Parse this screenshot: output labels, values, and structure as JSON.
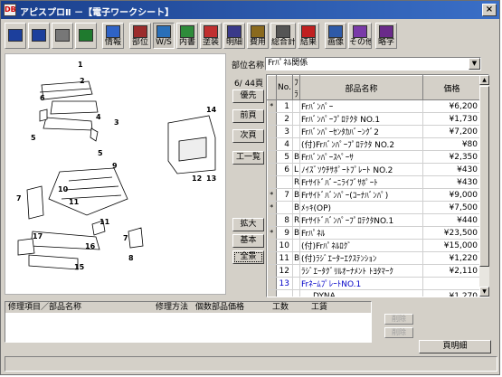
{
  "window": {
    "app_icon": "DB",
    "title": "アピスプロⅡ －【電子ワークシート】",
    "close_label": "×"
  },
  "toolbar": {
    "buttons": [
      {
        "icon": "save-icon",
        "label": "",
        "color": "#1c3f9c"
      },
      {
        "icon": "save-as-icon",
        "label": "",
        "color": "#1c3f9c"
      },
      {
        "icon": "print-icon",
        "label": "",
        "color": "#777777"
      },
      {
        "icon": "exit-door-icon",
        "label": "",
        "color": "#1f7a2e"
      },
      {
        "icon": "info-icon",
        "label": "情報",
        "color": "#2f63c6"
      },
      {
        "icon": "parts-icon",
        "label": "部位",
        "color": "#9b2c2c"
      },
      {
        "icon": "worksheet-icon",
        "label": "W/S",
        "color": "#2a6fb8"
      },
      {
        "icon": "details-icon",
        "label": "内書",
        "color": "#2e8b3a"
      },
      {
        "icon": "paint-icon",
        "label": "塗装",
        "color": "#c03030"
      },
      {
        "icon": "statement-icon",
        "label": "明細",
        "color": "#3a3a8a"
      },
      {
        "icon": "cost-icon",
        "label": "費用",
        "color": "#8a6a1e"
      },
      {
        "icon": "total-icon",
        "label": "総合計",
        "color": "#555555"
      },
      {
        "icon": "result-icon",
        "label": "結果",
        "color": "#c02020"
      },
      {
        "icon": "image-icon",
        "label": "画像",
        "color": "#2e5aa8"
      },
      {
        "icon": "other-icon",
        "label": "その他",
        "color": "#7a3aa8"
      },
      {
        "icon": "abbreviation-icon",
        "label": "略字",
        "color": "#6a2a8a"
      }
    ]
  },
  "parts_field": {
    "label": "部位名称",
    "value": "Frﾊﾟﾈﾙ関係"
  },
  "page_indicator": "6/ 44頁",
  "nav_buttons": {
    "priority": "優先",
    "prev": "前頁",
    "next": "次頁",
    "list": "工一覧"
  },
  "zoom_buttons": {
    "zoom_in": "拡大",
    "base": "基本",
    "full": "全景"
  },
  "diagram_labels": [
    "1",
    "2",
    "3",
    "4",
    "5",
    "5",
    "6",
    "7",
    "7",
    "8",
    "9",
    "10",
    "11",
    "11",
    "12",
    "13",
    "14",
    "15",
    "16",
    "17"
  ],
  "grid": {
    "columns": [
      "No.",
      "ﾌﾗ",
      "部品名称",
      "価格"
    ],
    "rows": [
      {
        "mark": "*",
        "no": "1",
        "flag": "",
        "name": "Frﾊﾞﾝﾊﾟｰ",
        "price": "¥6,200"
      },
      {
        "mark": "",
        "no": "2",
        "flag": "",
        "name": "Frﾊﾞﾝﾊﾟｰﾌﾟﾛﾃｸﾀ NO.1",
        "price": "¥1,730"
      },
      {
        "mark": "",
        "no": "3",
        "flag": "",
        "name": "Frﾊﾞﾝﾊﾟｰｾﾝﾀｶﾊﾞｰﾝｸﾞ2",
        "price": "¥7,200"
      },
      {
        "mark": "",
        "no": "4",
        "flag": "",
        "name": "(付)Frﾊﾞﾝﾊﾟｰﾌﾟﾛﾃｸﾀ NO.2",
        "price": "¥80"
      },
      {
        "mark": "",
        "no": "5",
        "flag": "B",
        "name": "Frﾊﾞﾝﾊﾟｰｽﾍﾟｰｻ",
        "price": "¥2,350"
      },
      {
        "mark": "",
        "no": "6",
        "flag": "L",
        "name": "ﾉｲｽﾞｿｳﾁｻﾎﾟｰﾄﾌﾟﾚｰﾄ NO.2",
        "price": "¥430"
      },
      {
        "mark": "",
        "no": "",
        "flag": "R",
        "name": "Frｻｲﾄﾞﾊﾞｰﾆﾗｲﾌﾞｻﾎﾟｰﾄ",
        "price": "¥430"
      },
      {
        "mark": "*",
        "no": "7",
        "flag": "B",
        "name": "Frｻｲﾄﾞﾊﾞﾝﾊﾟｰ(ｺｰﾅﾊﾞﾝﾊﾟ)",
        "price": "¥9,000"
      },
      {
        "mark": "*",
        "no": "",
        "flag": "B",
        "name": "ﾒｯｷ(OP)",
        "price": "¥7,500"
      },
      {
        "mark": "",
        "no": "8",
        "flag": "R",
        "name": "FrｻｲﾄﾞﾊﾞﾝﾊﾟｰﾌﾟﾛﾃｸﾀNO.1",
        "price": "¥440"
      },
      {
        "mark": "*",
        "no": "9",
        "flag": "B",
        "name": "Frﾊﾟﾈﾙ",
        "price": "¥23,500"
      },
      {
        "mark": "",
        "no": "10",
        "flag": "",
        "name": "(付)Frﾊﾟﾈﾙﾛｸﾞ",
        "price": "¥15,000"
      },
      {
        "mark": "",
        "no": "11",
        "flag": "B",
        "name": "(付)ﾗｼﾞｴｰﾀｰｴｸｽﾃﾝｼｮﾝ",
        "price": "¥1,220"
      },
      {
        "mark": "",
        "no": "12",
        "flag": "",
        "name": "ﾗｼﾞｴｰﾀｸﾞﾘﾙｵｰﾅﾒﾝﾄ ﾄﾖﾀﾏｰｸ",
        "price": "¥2,110"
      },
      {
        "mark": "",
        "no": "13",
        "flag": "",
        "name": "FrﾈｰﾑﾌﾟﾚｰﾄNO.1",
        "price": "",
        "selected": true
      },
      {
        "mark": "",
        "no": "",
        "flag": "",
        "name": "DYNA",
        "price": "¥1,270",
        "indent": true
      }
    ]
  },
  "bottom_panel": {
    "headers": [
      "修理項目／部品名称",
      "修理方法",
      "個数",
      "部品価格",
      "工数",
      "工賃"
    ],
    "delete_label": "削除",
    "delete_all_label": "削除"
  },
  "print_button": "頁明細"
}
